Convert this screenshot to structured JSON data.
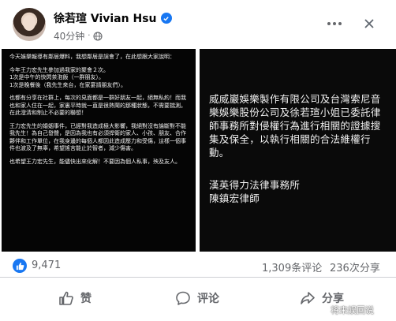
{
  "post": {
    "author": "徐若瑄 Vivian Hsu",
    "time": "40分钟",
    "separator": "·"
  },
  "image_left": {
    "paragraphs": [
      "今天娛樂報導有鄰居爆料，我想鄰居是誤會了，在此想跟大家說明：",
      "今年王力宏先生參加過我家的聚會２次。\n1次是中午的快閃茶泡飯（一群朋友）。\n1次是晚餐後（我先生來台，在家宴請朋友們）。",
      "也都有分享在社群上，每次的見面都是一群好朋友一起，絕無私約！而我也和家人住在一起，家裏平時就一直是很熱鬧的那種狀態，不需要揣測。在此澄清和制止不必要的聯想！",
      "王力宏先生的婚姻事件，已經對我造成極大影響，我絕對沒有論斷對不能我先生！為自己發聲，是因為我也有必須捍衛的家人、小孩、朋友、合作夥伴和工作單位，在我身邊的每個人都因此造成壓力和受傷，這樣一個事件也波及了無辜，希望謠言能止於智者，減少傷害。",
      "也希望王力宏先生，能儘快出來化解！不要因為個人私事，殃及友人。"
    ]
  },
  "image_right": {
    "statement": "威威巖娛樂製作有限公司及台灣索尼音樂娛樂股份公司及徐若瑄小姐已委託律師事務所對侵權行為進行相關的證據搜集及保全，以執行相關的合法維權行動。",
    "firm": "漢英得力法律事務所\n陳鎮宏律師"
  },
  "stats": {
    "likes": "9,471",
    "comments": "1,309条评论",
    "shares": "236次分享"
  },
  "actions": {
    "like": "赞",
    "comment": "评论",
    "share": "分享"
  },
  "watermark": "将来娱回说",
  "colors": {
    "accent": "#1877f2",
    "secondary_text": "#65676b",
    "image_bg": "#050505"
  }
}
